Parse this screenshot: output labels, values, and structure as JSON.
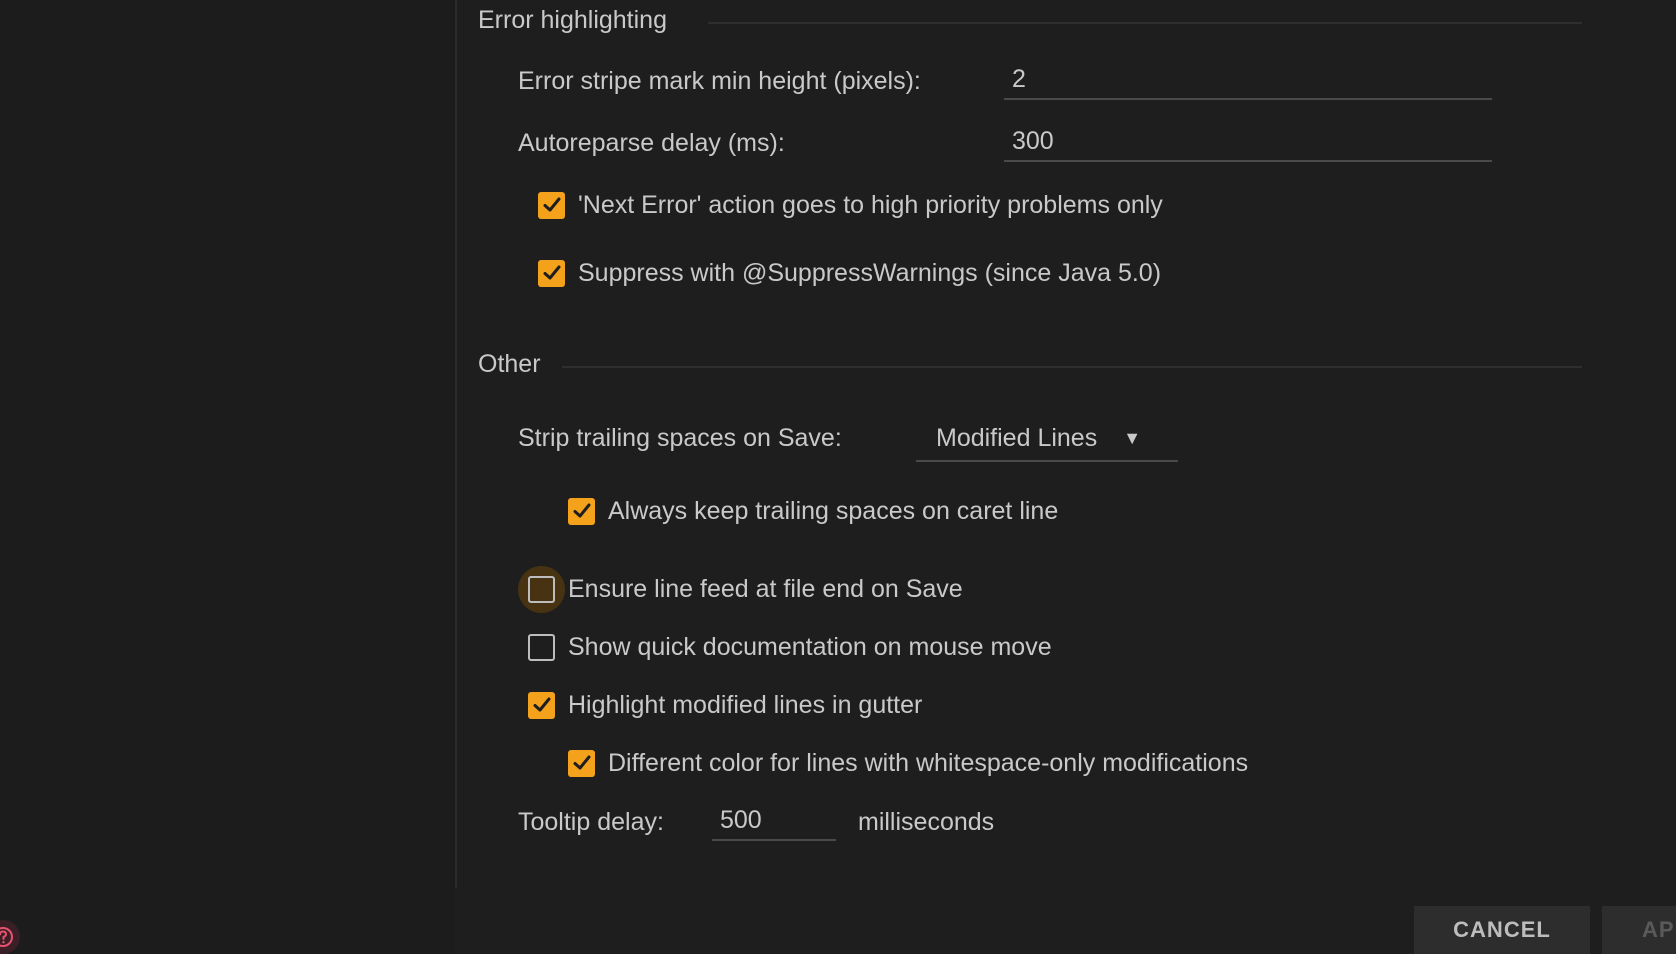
{
  "colors": {
    "background": "#1e1e1e",
    "accent_checkbox": "#f4a11c",
    "text": "#c9c9c9"
  },
  "error_highlighting": {
    "title": "Error highlighting",
    "stripe_label": "Error stripe mark min height (pixels):",
    "stripe_value": "2",
    "autoreparse_label": "Autoreparse delay (ms):",
    "autoreparse_value": "300",
    "checkboxes": [
      {
        "label": "'Next Error' action goes to high priority problems only",
        "checked": true
      },
      {
        "label": "Suppress with @SuppressWarnings (since Java 5.0)",
        "checked": true
      }
    ]
  },
  "other": {
    "title": "Other",
    "strip_label": "Strip trailing spaces on Save:",
    "strip_value": "Modified Lines",
    "strip_icon": "dropdown-arrow-icon",
    "checkboxes": [
      {
        "label": "Always keep trailing spaces on caret line",
        "checked": true
      },
      {
        "label": "Ensure line feed at file end on Save",
        "checked": false,
        "focused": true
      },
      {
        "label": "Show quick documentation on mouse move",
        "checked": false
      },
      {
        "label": "Highlight modified lines in gutter",
        "checked": true
      },
      {
        "label": "Different color for lines with whitespace-only modifications",
        "checked": true
      }
    ],
    "tooltip_label": "Tooltip delay:",
    "tooltip_value": "500",
    "tooltip_unit": "milliseconds"
  },
  "footer": {
    "help_icon": "help-icon",
    "cancel_label": "CANCEL",
    "apply_label": "AP"
  }
}
